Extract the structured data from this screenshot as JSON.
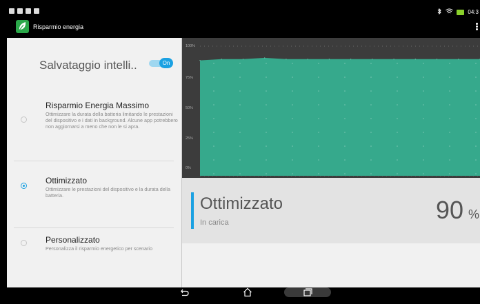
{
  "app": {
    "title": "Risparmio energia"
  },
  "statusbar": {
    "time": "04:3"
  },
  "smart_saving": {
    "label": "Salvataggio intelli..",
    "toggle_text": "On"
  },
  "options": [
    {
      "title": "Risparmio Energia Massimo",
      "description": "Ottimizzare la durata della batteria limitando le prestazioni del dispositivo e i dati in background. Alcune app potrebbero non aggiornarsi a meno che non le si apra.",
      "selected": false
    },
    {
      "title": "Ottimizzato",
      "description": "Ottimizzare le prestazioni del dispositivo e la durata della batteria.",
      "selected": true
    },
    {
      "title": "Personalizzato",
      "description": "Personalizza il risparmio energetico per scenario",
      "selected": false
    }
  ],
  "chart_data": {
    "type": "area",
    "y_ticks": [
      "100%",
      "75%",
      "50%",
      "25%",
      "0%"
    ],
    "ylim": [
      0,
      100
    ],
    "x": [
      0,
      1,
      2,
      3,
      4,
      5,
      6,
      7,
      8,
      9,
      10,
      11,
      12,
      13
    ],
    "series": [
      {
        "values": [
          89,
          90,
          90,
          91,
          90,
          90,
          90,
          90,
          90,
          90,
          90,
          90,
          90,
          90
        ]
      }
    ],
    "fill_color": "#36a98c",
    "background_color": "#3c3c3c",
    "grid": true
  },
  "battery_status": {
    "mode": "Ottimizzato",
    "state": "In carica",
    "percent": "90",
    "percent_sign": "%"
  },
  "colors": {
    "accent": "#1ba1e2",
    "app_icon": "#2ba84a"
  }
}
